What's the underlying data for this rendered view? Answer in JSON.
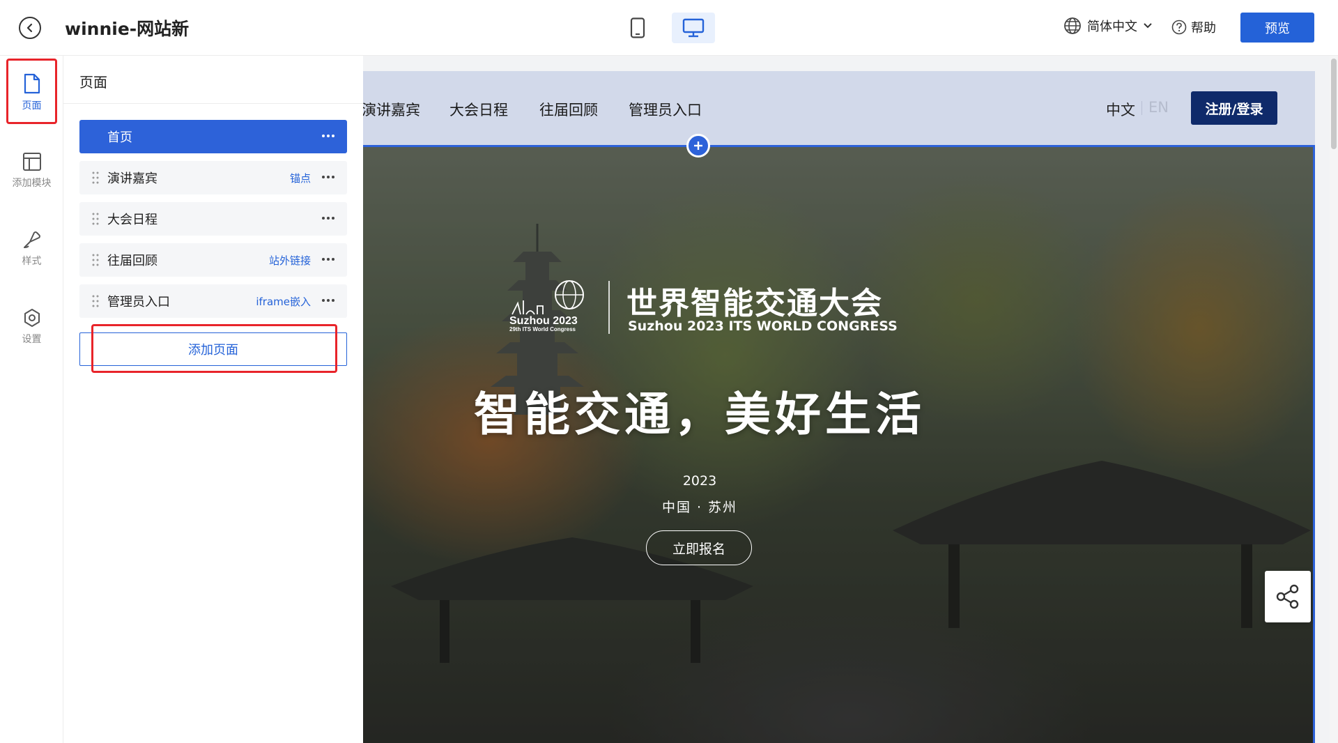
{
  "app": {
    "site_title": "winnie-网站新",
    "language": "简体中文",
    "help": "帮助",
    "preview": "预览",
    "devices": [
      "mobile",
      "desktop"
    ],
    "active_device": "desktop",
    "accent": "#2462d8"
  },
  "rail": {
    "items": [
      {
        "label": "页面",
        "icon": "page-icon",
        "active": true
      },
      {
        "label": "添加模块",
        "icon": "layout-icon",
        "active": false
      },
      {
        "label": "样式",
        "icon": "brush-icon",
        "active": false
      },
      {
        "label": "设置",
        "icon": "settings-icon",
        "active": false
      }
    ]
  },
  "pages_panel": {
    "title": "页面",
    "pages": [
      {
        "name": "首页",
        "tag": "",
        "active": true
      },
      {
        "name": "演讲嘉宾",
        "tag": "锚点",
        "active": false
      },
      {
        "name": "大会日程",
        "tag": "",
        "active": false
      },
      {
        "name": "往届回顾",
        "tag": "站外链接",
        "active": false
      },
      {
        "name": "管理员入口",
        "tag": "iframe嵌入",
        "active": false
      }
    ],
    "add_page": "添加页面"
  },
  "site_preview": {
    "nav": {
      "links": [
        "演讲嘉宾",
        "大会日程",
        "往届回顾",
        "管理员入口"
      ],
      "lang_zh": "中文",
      "lang_en": "EN",
      "login": "注册/登录"
    },
    "hero": {
      "logo_text_line1": "Suzhou 2023",
      "logo_text_line2": "29th ITS World Congress",
      "title_zh": "世界智能交通大会",
      "title_en": "Suzhou 2023 ITS WORLD CONGRESS",
      "slogan": "智能交通，美好生活",
      "year": "2023",
      "place": "中国 · 苏州",
      "cta": "立即报名"
    }
  },
  "highlight_color": "#e8242a"
}
